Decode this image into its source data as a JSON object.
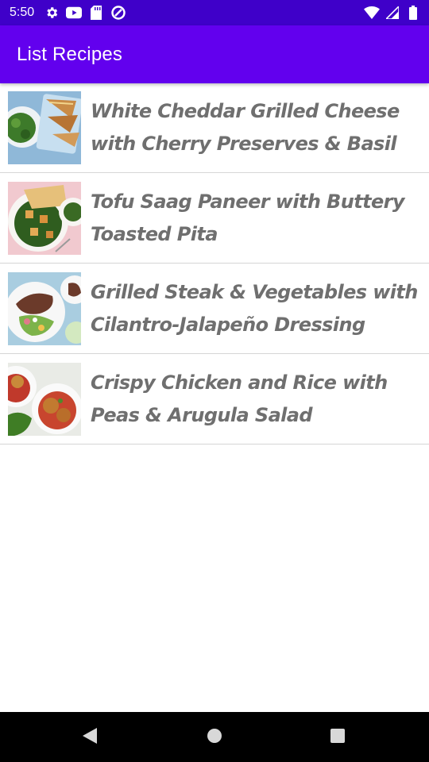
{
  "status_bar": {
    "time": "5:50",
    "left_icons": [
      "gear-icon",
      "youtube-icon",
      "sd-card-icon",
      "data-saver-icon"
    ],
    "right_icons": [
      "wifi-icon",
      "cellular-signal-icon",
      "battery-icon"
    ]
  },
  "app_bar": {
    "title": "List Recipes",
    "color": "#6200ee",
    "status_color": "#3f00c9"
  },
  "recipes": [
    {
      "title": "White Cheddar Grilled Cheese with Cherry Preserves & Basil"
    },
    {
      "title": "Tofu Saag Paneer with Buttery Toasted Pita"
    },
    {
      "title": "Grilled Steak & Vegetables with Cilantro-Jalapeño Dressing"
    },
    {
      "title": "Crispy Chicken and Rice with Peas & Arugula Salad"
    }
  ],
  "navigation": {
    "buttons": [
      "back-icon",
      "home-icon",
      "recents-icon"
    ]
  }
}
